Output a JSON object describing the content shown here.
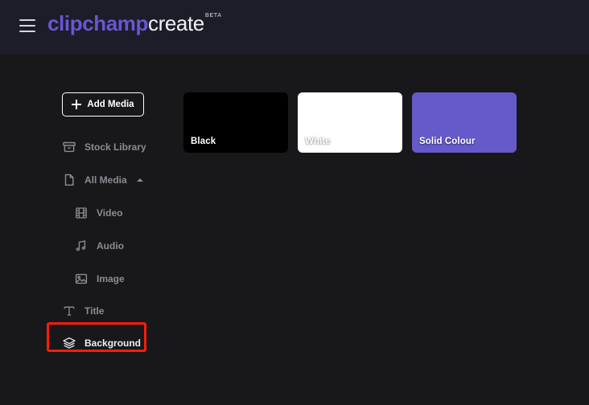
{
  "header": {
    "menu_icon": "hamburger-menu-icon",
    "brand_primary": "clipchamp",
    "brand_secondary": "create",
    "brand_badge": "BETA",
    "brand_color": "#6657d6",
    "background_color": "#1c1d28"
  },
  "sidebar": {
    "add_media_label": "Add Media",
    "items": [
      {
        "label": "Stock Library",
        "icon": "stock-library-icon",
        "selected": false
      },
      {
        "label": "All Media",
        "icon": "file-icon",
        "selected": false,
        "expanded": true,
        "chevron": "chevron-up-icon"
      },
      {
        "label": "Video",
        "icon": "film-icon",
        "selected": false
      },
      {
        "label": "Audio",
        "icon": "music-note-icon",
        "selected": false
      },
      {
        "label": "Image",
        "icon": "picture-icon",
        "selected": false
      },
      {
        "label": "Title",
        "icon": "text-t-icon",
        "selected": false
      },
      {
        "label": "Background",
        "icon": "layers-icon",
        "selected": true
      }
    ],
    "highlight_color": "#fa1d0c",
    "highlighted_item": "Background"
  },
  "main": {
    "cards": [
      {
        "label": "Black",
        "color": "#000000",
        "label_on_light": false
      },
      {
        "label": "White",
        "color": "#ffffff",
        "label_on_light": true
      },
      {
        "label": "Solid Colour",
        "color": "#6659c9",
        "label_on_light": false
      }
    ]
  }
}
